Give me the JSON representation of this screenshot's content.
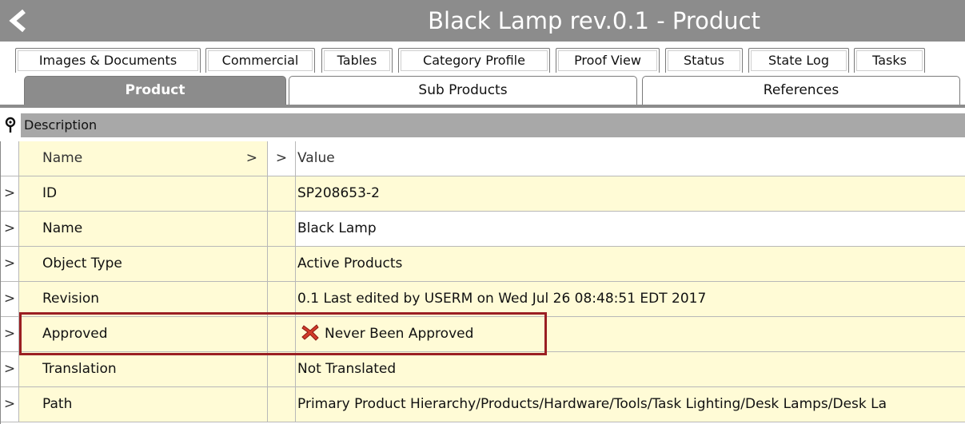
{
  "window": {
    "title": "Black Lamp rev.0.1 - Product",
    "back_icon": "chevron-left-icon",
    "titlebar_color": "#8c8c8c"
  },
  "tabs_top": [
    {
      "label": "Images & Documents"
    },
    {
      "label": "Commercial"
    },
    {
      "label": "Tables"
    },
    {
      "label": "Category Profile"
    },
    {
      "label": "Proof View"
    },
    {
      "label": "Status"
    },
    {
      "label": "State Log"
    },
    {
      "label": "Tasks"
    }
  ],
  "tabs_main": [
    {
      "label": "Product",
      "active": true
    },
    {
      "label": "Sub Products",
      "active": false
    },
    {
      "label": "References",
      "active": false
    }
  ],
  "section": {
    "label": "Description",
    "icon": "pin-icon"
  },
  "grid": {
    "header": {
      "name": "Name",
      "name_chevron": ">",
      "value_chevron": ">",
      "value": "Value"
    },
    "row_chevron": ">",
    "rows": [
      {
        "name": "ID",
        "value": "SP208653-2"
      },
      {
        "name": "Name",
        "value": "Black Lamp"
      },
      {
        "name": "Object Type",
        "value": "Active Products"
      },
      {
        "name": "Revision",
        "value": "0.1 Last edited by USERM on Wed Jul 26 08:48:51 EDT 2017"
      },
      {
        "name": "Approved",
        "value": "Never Been Approved",
        "icon": "red-x-icon"
      },
      {
        "name": "Translation",
        "value": "Not Translated"
      },
      {
        "name": "Path",
        "value": "Primary Product Hierarchy/Products/Hardware/Tools/Task Lighting/Desk Lamps/Desk La"
      }
    ]
  },
  "colors": {
    "row_yellow": "#fffbd6",
    "highlight_border": "#9a1e22",
    "active_tab": "#8c8c8c"
  }
}
